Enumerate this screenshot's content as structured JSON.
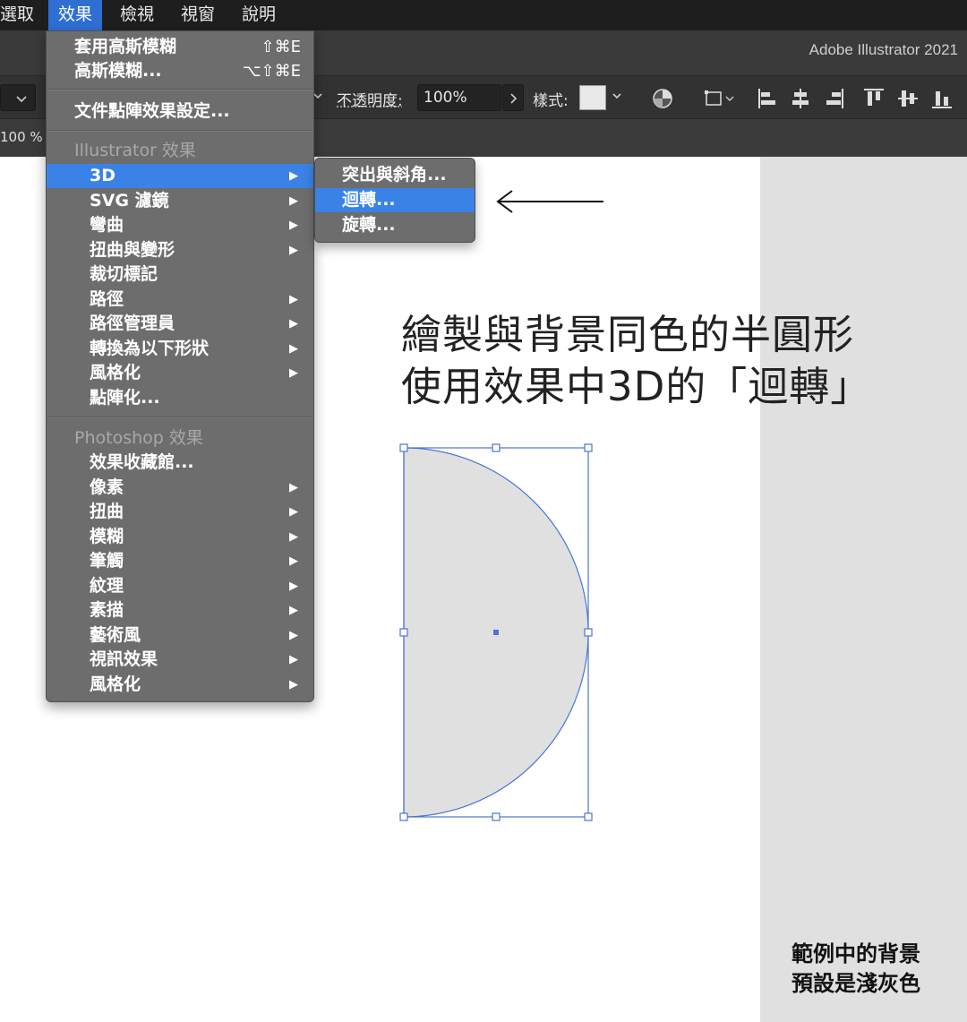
{
  "menubar": {
    "items": [
      {
        "label": "選取"
      },
      {
        "label": "效果",
        "active": true
      },
      {
        "label": "檢視"
      },
      {
        "label": "視窗"
      },
      {
        "label": "說明"
      }
    ]
  },
  "app": {
    "title": "Adobe Illustrator 2021"
  },
  "controlbar": {
    "opacity_label": "不透明度:",
    "opacity_value": "100%",
    "style_label": "樣式:",
    "zoom_value": "100 %"
  },
  "effect_menu": {
    "apply_last": {
      "label": "套用高斯模糊",
      "shortcut": "⇧⌘E"
    },
    "last_effect": {
      "label": "高斯模糊...",
      "shortcut": "⌥⇧⌘E"
    },
    "document_raster": {
      "label": "文件點陣效果設定..."
    },
    "illustrator_header": "Illustrator 效果",
    "illustrator_items": [
      {
        "label": "3D",
        "submenu": true,
        "highlighted": true
      },
      {
        "label": "SVG 濾鏡",
        "submenu": true
      },
      {
        "label": "彎曲",
        "submenu": true
      },
      {
        "label": "扭曲與變形",
        "submenu": true
      },
      {
        "label": "裁切標記",
        "submenu": false
      },
      {
        "label": "路徑",
        "submenu": true
      },
      {
        "label": "路徑管理員",
        "submenu": true
      },
      {
        "label": "轉換為以下形狀",
        "submenu": true
      },
      {
        "label": "風格化",
        "submenu": true
      },
      {
        "label": "點陣化...",
        "submenu": false
      }
    ],
    "photoshop_header": "Photoshop 效果",
    "photoshop_items": [
      {
        "label": "效果收藏館...",
        "submenu": false
      },
      {
        "label": "像素",
        "submenu": true
      },
      {
        "label": "扭曲",
        "submenu": true
      },
      {
        "label": "模糊",
        "submenu": true
      },
      {
        "label": "筆觸",
        "submenu": true
      },
      {
        "label": "紋理",
        "submenu": true
      },
      {
        "label": "素描",
        "submenu": true
      },
      {
        "label": "藝術風",
        "submenu": true
      },
      {
        "label": "視訊效果",
        "submenu": true
      },
      {
        "label": "風格化",
        "submenu": true
      }
    ]
  },
  "submenu_3d": {
    "items": [
      {
        "label": "突出與斜角..."
      },
      {
        "label": "迴轉...",
        "highlighted": true
      },
      {
        "label": "旋轉..."
      }
    ]
  },
  "canvas": {
    "heading_line1": "繪製與背景同色的半圓形",
    "heading_line2": "使用效果中3D的「迴轉」",
    "note_line1": "範例中的背景",
    "note_line2": "預設是淺灰色"
  },
  "colors": {
    "menu_highlight": "#3b82e6",
    "menubar_active": "#2f6fd3",
    "shape_fill": "#e0e0e0",
    "selection": "#4a74d4"
  }
}
